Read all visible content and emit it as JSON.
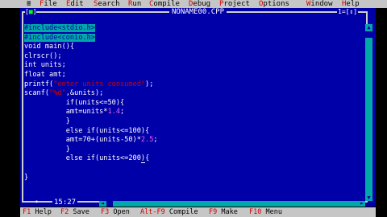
{
  "menubar": {
    "system": "≡",
    "items": [
      {
        "hotkey": "F",
        "rest": "ile"
      },
      {
        "hotkey": "E",
        "rest": "dit"
      },
      {
        "hotkey": "S",
        "rest": "earch"
      },
      {
        "hotkey": "R",
        "rest": "un"
      },
      {
        "hotkey": "C",
        "rest": "ompile"
      },
      {
        "hotkey": "D",
        "rest": "ebug"
      },
      {
        "hotkey": "P",
        "rest": "roject"
      },
      {
        "hotkey": "O",
        "rest": "ptions"
      },
      {
        "hotkey": "W",
        "rest": "indow"
      },
      {
        "hotkey": "H",
        "rest": "elp"
      }
    ]
  },
  "window": {
    "close": "[",
    "close_mark": "■",
    "close_end": "]",
    "title": "NONAME00.CPP",
    "number": "1=[↕]",
    "zoom": "",
    "cursor_pos": "15:27",
    "modified_marker": "*"
  },
  "code": {
    "lines": [
      [
        {
          "t": "#include<stdio.h>",
          "c": "sel"
        }
      ],
      [
        {
          "t": "#include<conio.h>",
          "c": "sel"
        }
      ],
      [
        {
          "t": "void main(){"
        }
      ],
      [
        {
          "t": "clrscr();"
        }
      ],
      [
        {
          "t": "int units;"
        }
      ],
      [
        {
          "t": "float amt;"
        }
      ],
      [
        {
          "t": "printf("
        },
        {
          "t": "\"enter units consumed\"",
          "c": "str"
        },
        {
          "t": ");"
        }
      ],
      [
        {
          "t": "scanf("
        },
        {
          "t": "\"%d\"",
          "c": "str"
        },
        {
          "t": ",&units);"
        }
      ],
      [
        {
          "t": "          if(units<=50){"
        }
      ],
      [
        {
          "t": "          amt=units*"
        },
        {
          "t": "1.4",
          "c": "num"
        },
        {
          "t": ";"
        }
      ],
      [
        {
          "t": "          }"
        }
      ],
      [
        {
          "t": "          else if(units<=100){"
        }
      ],
      [
        {
          "t": "          amt=70+(units-50)*"
        },
        {
          "t": "2.5",
          "c": "num"
        },
        {
          "t": ";"
        }
      ],
      [
        {
          "t": "          }"
        }
      ],
      [
        {
          "t": "          else if(units<=200"
        },
        {
          "t": ")",
          "c": "cursor"
        },
        {
          "t": "{"
        }
      ],
      [
        {
          "t": ""
        }
      ],
      [
        {
          "t": "}"
        }
      ]
    ]
  },
  "statusbar": [
    {
      "key": "F1",
      "label": " Help"
    },
    {
      "key": "F2",
      "label": " Save"
    },
    {
      "key": "F3",
      "label": " Open"
    },
    {
      "key": "Alt-F9",
      "label": " Compile"
    },
    {
      "key": "F9",
      "label": " Make"
    },
    {
      "key": "F10",
      "label": " Menu"
    }
  ],
  "colors": {
    "editor_bg": "#0000a8",
    "menu_bg": "#c6c6c6",
    "hotkey": "#d00000",
    "selection": "#00a8a8",
    "string": "#d00000",
    "number": "#ff55ff"
  }
}
